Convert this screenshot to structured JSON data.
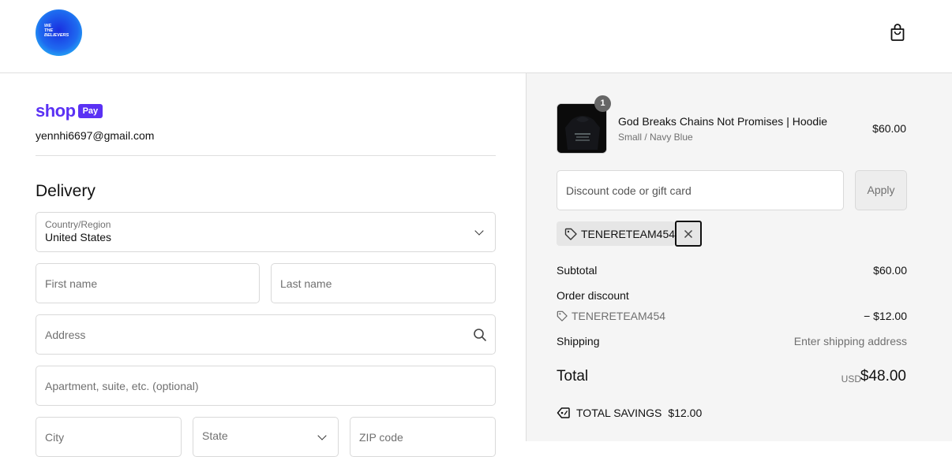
{
  "header": {
    "logo_lines": [
      "WE",
      "THE",
      "BELIEVERS"
    ],
    "cart_icon": "shopping-bag-icon"
  },
  "express": {
    "shop_word": "shop",
    "pay_badge": "Pay",
    "email": "yennhi6697@gmail.com"
  },
  "delivery": {
    "heading": "Delivery",
    "country_label": "Country/Region",
    "country_value": "United States",
    "first_name_placeholder": "First name",
    "last_name_placeholder": "Last name",
    "address_placeholder": "Address",
    "apartment_placeholder": "Apartment, suite, etc. (optional)",
    "city_placeholder": "City",
    "state_placeholder": "State",
    "zip_placeholder": "ZIP code"
  },
  "summary": {
    "item": {
      "quantity": "1",
      "name": "God Breaks Chains Not Promises | Hoodie",
      "variant": "Small / Navy Blue",
      "price": "$60.00"
    },
    "discount_placeholder": "Discount code or gift card",
    "apply_label": "Apply",
    "applied_code": "TENERETEAM454",
    "remove_icon": "close-icon",
    "subtotal_label": "Subtotal",
    "subtotal_value": "$60.00",
    "order_discount_label": "Order discount",
    "discount_code": "TENERETEAM454",
    "discount_value": "− $12.00",
    "shipping_label": "Shipping",
    "shipping_value": "Enter shipping address",
    "total_label": "Total",
    "currency": "USD",
    "total_value": "$48.00",
    "savings_label": "TOTAL SAVINGS",
    "savings_value": "$12.00"
  },
  "colors": {
    "shop_pay_purple": "#5a31f4",
    "summary_bg": "#f5f5f5"
  }
}
